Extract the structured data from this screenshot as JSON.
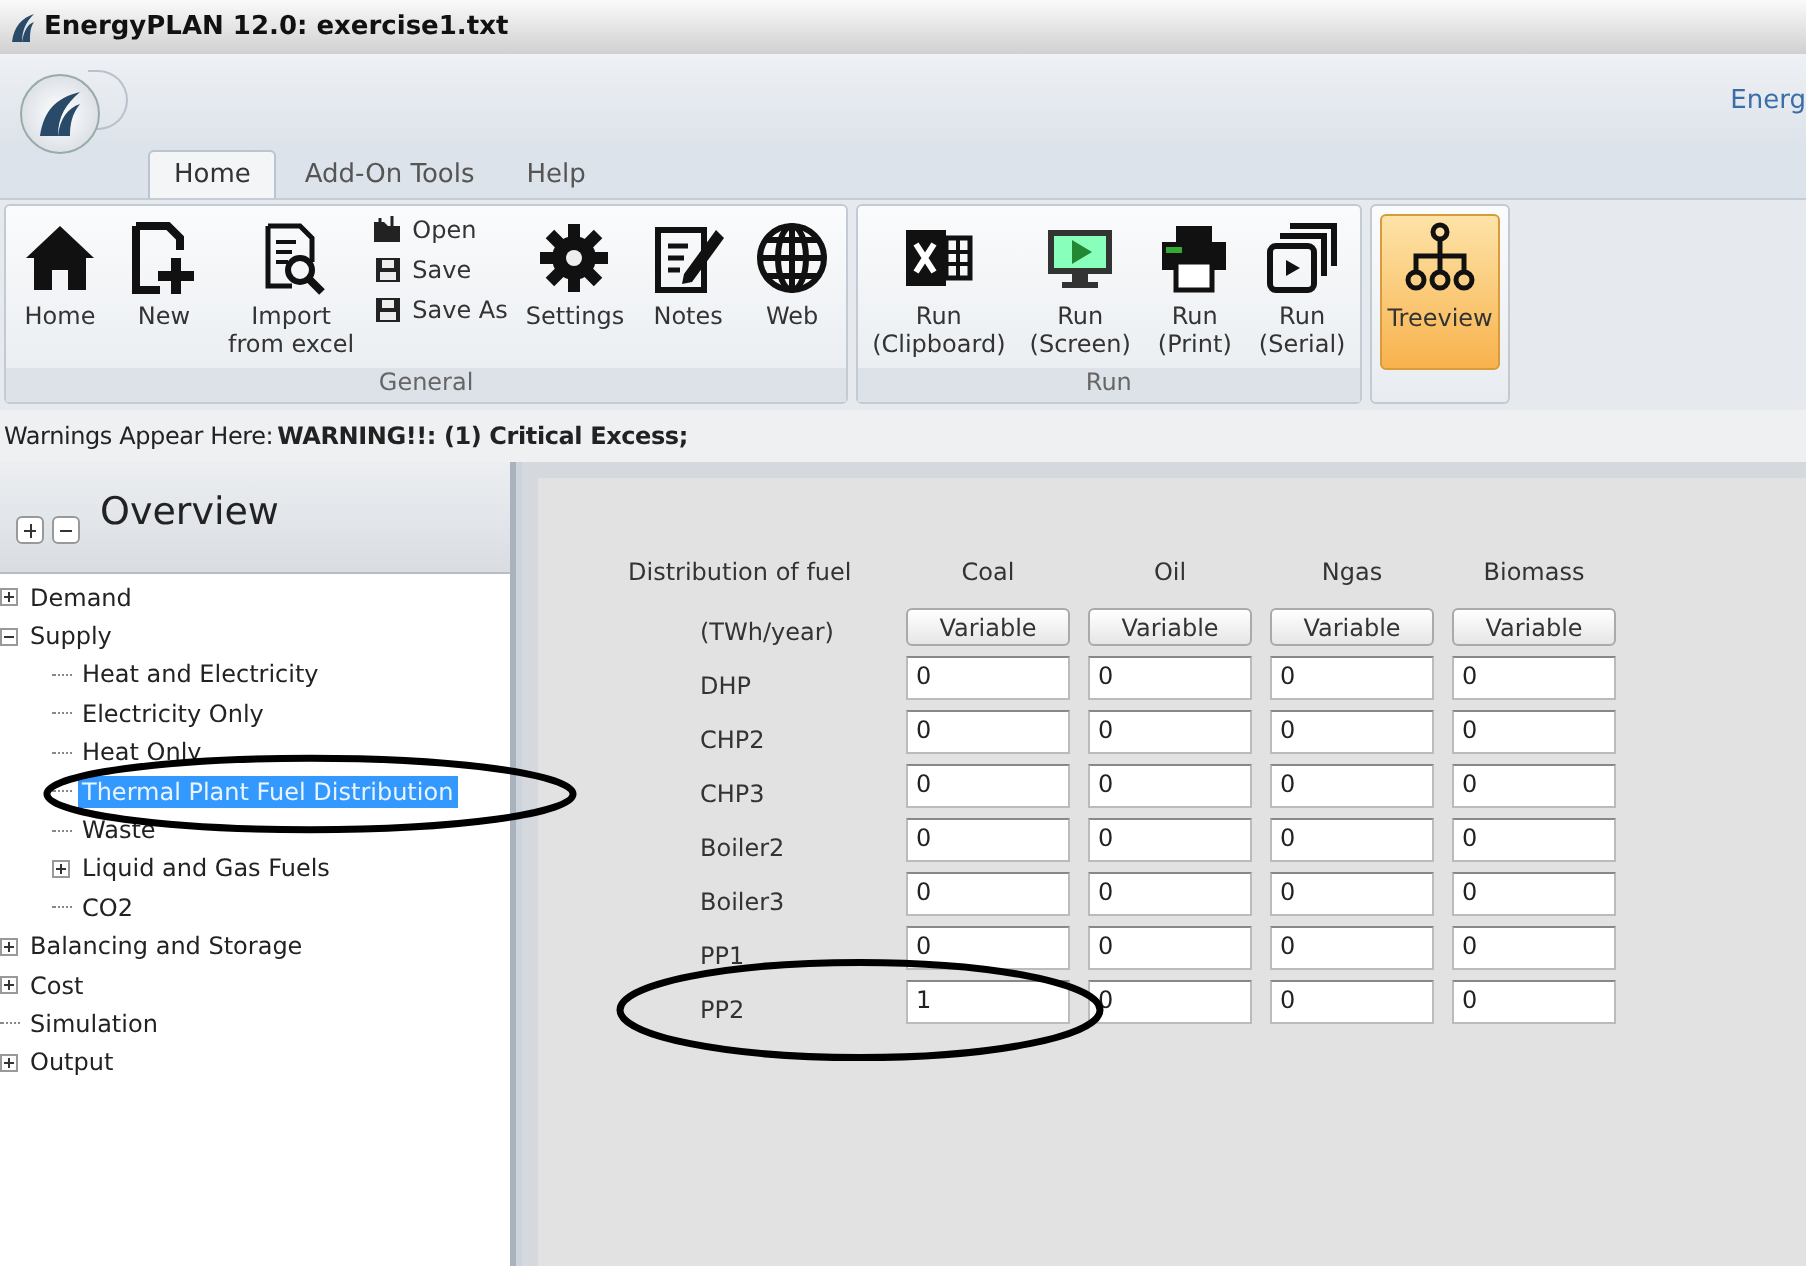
{
  "window": {
    "title": "EnergyPLAN 12.0: exercise1.txt"
  },
  "quick_access": {
    "caption": "Energ"
  },
  "tabs": [
    {
      "label": "Home",
      "selected": true
    },
    {
      "label": "Add-On Tools",
      "selected": false
    },
    {
      "label": "Help",
      "selected": false
    }
  ],
  "ribbon": {
    "groups": [
      {
        "label": "General",
        "items": [
          {
            "kind": "large",
            "label": "Home",
            "selected": false
          },
          {
            "kind": "large",
            "label": "New",
            "selected": false
          },
          {
            "kind": "large",
            "label": "Import\nfrom excel",
            "selected": false
          },
          {
            "kind": "stack",
            "items": [
              "Open",
              "Save",
              "Save As"
            ]
          },
          {
            "kind": "large",
            "label": "Settings",
            "selected": false
          },
          {
            "kind": "large",
            "label": "Notes",
            "selected": false
          },
          {
            "kind": "large",
            "label": "Web",
            "selected": false
          }
        ]
      },
      {
        "label": "Run",
        "items": [
          {
            "kind": "large",
            "label": "Run\n(Clipboard)",
            "selected": false
          },
          {
            "kind": "large",
            "label": "Run\n(Screen)",
            "selected": false
          },
          {
            "kind": "large",
            "label": "Run\n(Print)",
            "selected": false
          },
          {
            "kind": "large",
            "label": "Run\n(Serial)",
            "selected": false
          }
        ]
      },
      {
        "items": [
          {
            "kind": "large",
            "label": "Treeview",
            "selected": true
          }
        ]
      }
    ]
  },
  "warning": {
    "prefix": "Warnings Appear Here:",
    "message": "WARNING!!: (1) Critical Excess;"
  },
  "sidebar": {
    "title": "Overview",
    "tree": [
      {
        "label": "Demand",
        "expanded": false,
        "selected": false
      },
      {
        "label": "Supply",
        "expanded": true,
        "selected": false,
        "children": [
          {
            "label": "Heat and Electricity",
            "selected": false
          },
          {
            "label": "Electricity Only",
            "selected": false
          },
          {
            "label": "Heat Only",
            "selected": false
          },
          {
            "label": "Thermal Plant Fuel Distribution",
            "selected": true
          },
          {
            "label": "Waste",
            "selected": false
          },
          {
            "label": "Liquid and Gas Fuels",
            "expanded": false,
            "selected": false
          },
          {
            "label": "CO2",
            "selected": false
          }
        ]
      },
      {
        "label": "Balancing and Storage",
        "expanded": false,
        "selected": false
      },
      {
        "label": "Cost",
        "expanded": false,
        "selected": false
      },
      {
        "label": "Simulation",
        "selected": false
      },
      {
        "label": "Output",
        "expanded": false,
        "selected": false
      }
    ]
  },
  "form": {
    "heading": "Distribution of fuel",
    "unit": "(TWh/year)",
    "columns": [
      {
        "label": "Coal",
        "button": "Variable"
      },
      {
        "label": "Oil",
        "button": "Variable"
      },
      {
        "label": "Ngas",
        "button": "Variable"
      },
      {
        "label": "Biomass",
        "button": "Variable"
      }
    ],
    "rows": [
      {
        "label": "DHP",
        "values": [
          "0",
          "0",
          "0",
          "0"
        ]
      },
      {
        "label": "CHP2",
        "values": [
          "0",
          "0",
          "0",
          "0"
        ]
      },
      {
        "label": "CHP3",
        "values": [
          "0",
          "0",
          "0",
          "0"
        ]
      },
      {
        "label": "Boiler2",
        "values": [
          "0",
          "0",
          "0",
          "0"
        ]
      },
      {
        "label": "Boiler3",
        "values": [
          "0",
          "0",
          "0",
          "0"
        ]
      },
      {
        "label": "PP1",
        "values": [
          "0",
          "0",
          "0",
          "0"
        ]
      },
      {
        "label": "PP2",
        "values": [
          "1",
          "0",
          "0",
          "0"
        ]
      }
    ]
  }
}
